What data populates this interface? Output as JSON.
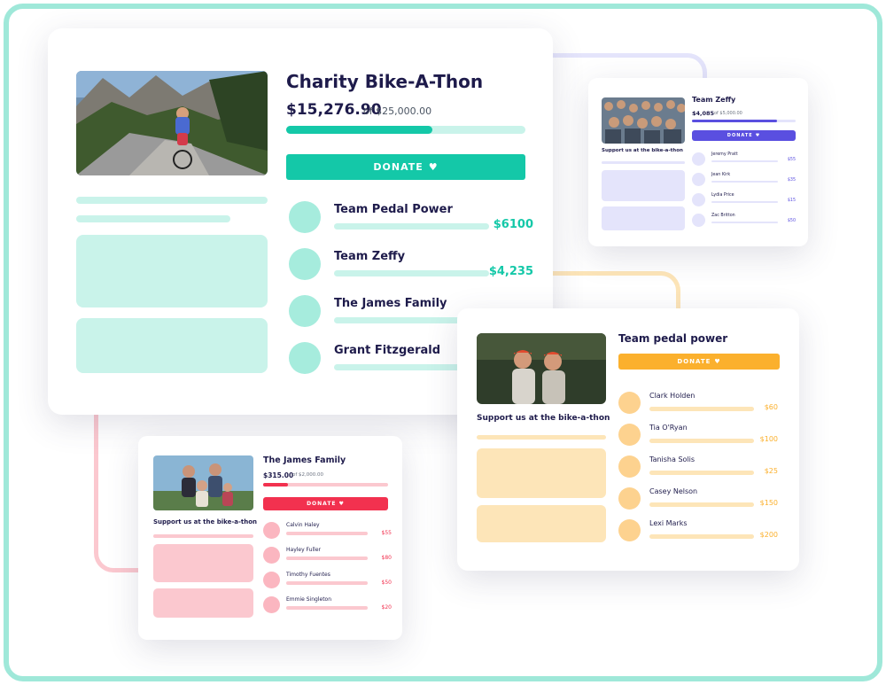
{
  "colors": {
    "frame": "#9fe8d9",
    "teal": "#14c8a8",
    "teal_light": "#c9f3ea",
    "purple": "#5a4fe0",
    "purple_light": "#e4e4fb",
    "orange": "#fbb02d",
    "orange_light": "#fde5b8",
    "red": "#f2314f",
    "red_light": "#fbc8cf"
  },
  "main": {
    "title": "Charity Bike-A-Thon",
    "raised": "$15,276.90",
    "goal_text": "of $25,000.00",
    "progress": 0.61,
    "donate_label": "DONATE",
    "teams": [
      {
        "name": "Team Pedal Power",
        "amount": "$6100",
        "progress": 1.0
      },
      {
        "name": "Team Zeffy",
        "amount": "$4,235",
        "progress": 0.69
      },
      {
        "name": "The James Family",
        "amount": "",
        "progress": 0.0
      },
      {
        "name": "Grant Fitzgerald",
        "amount": "",
        "progress": 0.0
      }
    ]
  },
  "zeffy": {
    "title": "Team Zeffy",
    "raised": "$4,085",
    "goal_text": "of $5,000.00",
    "progress": 0.82,
    "donate_label": "DONATE",
    "support_text": "Support us at the bike-a-thon",
    "donors": [
      {
        "name": "Jeremy Pratt",
        "amount": "$55"
      },
      {
        "name": "Jean Kirk",
        "amount": "$35"
      },
      {
        "name": "Lydia Price",
        "amount": "$15"
      },
      {
        "name": "Zac Britton",
        "amount": "$50"
      }
    ]
  },
  "pedal": {
    "title": "Team pedal power",
    "donate_label": "DONATE",
    "support_text": "Support us at the bike-a-thon",
    "donors": [
      {
        "name": "Clark Holden",
        "amount": "$60"
      },
      {
        "name": "Tia O'Ryan",
        "amount": "$100"
      },
      {
        "name": "Tanisha Solis",
        "amount": "$25"
      },
      {
        "name": "Casey Nelson",
        "amount": "$150"
      },
      {
        "name": "Lexi Marks",
        "amount": "$200"
      }
    ]
  },
  "james": {
    "title": "The James Family",
    "raised": "$315.00",
    "goal_text": "of $2,000.00",
    "progress": 0.2,
    "donate_label": "DONATE",
    "support_text": "Support us at the bike-a-thon",
    "donors": [
      {
        "name": "Calvin Haley",
        "amount": "$55"
      },
      {
        "name": "Hayley Fuller",
        "amount": "$80"
      },
      {
        "name": "Timothy Fuentes",
        "amount": "$50"
      },
      {
        "name": "Emmie Singleton",
        "amount": "$20"
      }
    ]
  }
}
